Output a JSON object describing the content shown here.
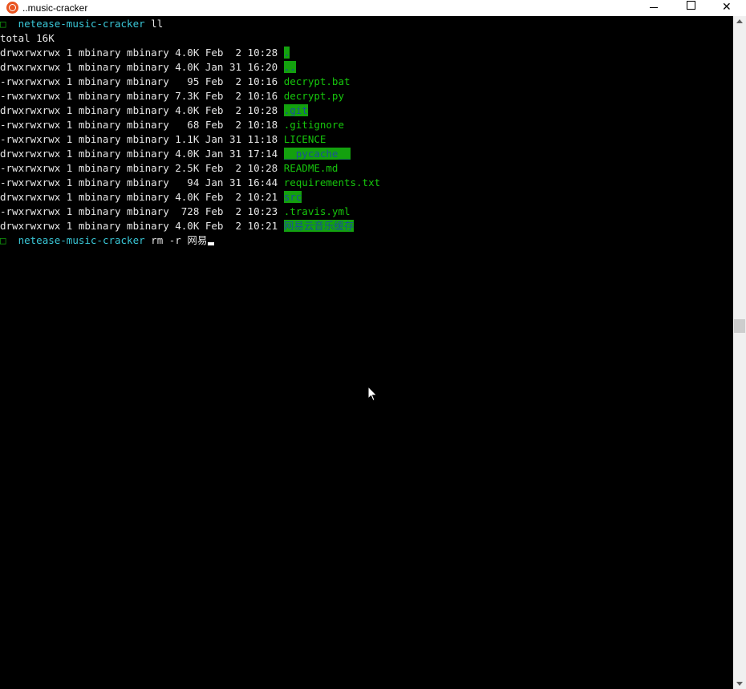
{
  "window": {
    "title": "..music-cracker",
    "icon": "ubuntu-icon",
    "controls": {
      "minimize": "minimize-icon",
      "maximize": "maximize-icon",
      "close": "close-icon"
    }
  },
  "colors": {
    "background": "#000000",
    "text": "#e6e6e6",
    "filename": "#16c60c",
    "dir_highlight_bg": "#13a10e",
    "dir_highlight_fg": "#1a4f9a",
    "prompt_dir": "#3ac8d8"
  },
  "terminal": {
    "prompt1": {
      "symbol": "□",
      "dir": "netease-music-cracker",
      "command": "ll"
    },
    "total": "total 16K",
    "listing": [
      {
        "meta": "drwxrwxrwx 1 mbinary mbinary 4.0K Feb  2 10:28",
        "name": ".",
        "dir": true
      },
      {
        "meta": "drwxrwxrwx 1 mbinary mbinary 4.0K Jan 31 16:20",
        "name": "..",
        "dir": true
      },
      {
        "meta": "-rwxrwxrwx 1 mbinary mbinary   95 Feb  2 10:16",
        "name": "decrypt.bat",
        "dir": false
      },
      {
        "meta": "-rwxrwxrwx 1 mbinary mbinary 7.3K Feb  2 10:16",
        "name": "decrypt.py",
        "dir": false
      },
      {
        "meta": "drwxrwxrwx 1 mbinary mbinary 4.0K Feb  2 10:28",
        "name": ".git",
        "dir": true
      },
      {
        "meta": "-rwxrwxrwx 1 mbinary mbinary   68 Feb  2 10:18",
        "name": ".gitignore",
        "dir": false
      },
      {
        "meta": "-rwxrwxrwx 1 mbinary mbinary 1.1K Jan 31 11:18",
        "name": "LICENCE",
        "dir": false
      },
      {
        "meta": "drwxrwxrwx 1 mbinary mbinary 4.0K Jan 31 17:14",
        "name": "__pycache__",
        "dir": true
      },
      {
        "meta": "-rwxrwxrwx 1 mbinary mbinary 2.5K Feb  2 10:28",
        "name": "README.md",
        "dir": false
      },
      {
        "meta": "-rwxrwxrwx 1 mbinary mbinary   94 Jan 31 16:44",
        "name": "requirements.txt",
        "dir": false
      },
      {
        "meta": "drwxrwxrwx 1 mbinary mbinary 4.0K Feb  2 10:21",
        "name": "src",
        "dir": true
      },
      {
        "meta": "-rwxrwxrwx 1 mbinary mbinary  728 Feb  2 10:23",
        "name": ".travis.yml",
        "dir": false
      },
      {
        "meta": "drwxrwxrwx 1 mbinary mbinary 4.0K Feb  2 10:21",
        "name": "网易云音乐缓存",
        "dir": true
      }
    ],
    "prompt2": {
      "symbol": "□",
      "dir": "netease-music-cracker",
      "command": "rm -r 网易"
    }
  }
}
